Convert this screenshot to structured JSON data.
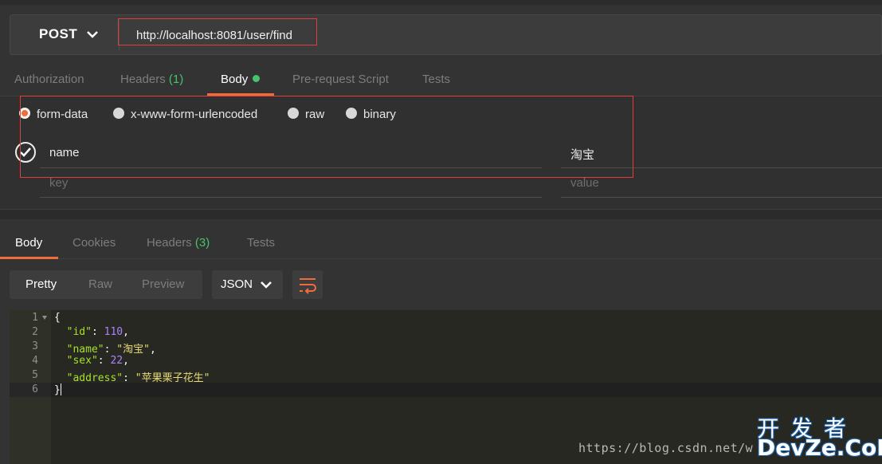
{
  "request": {
    "method": "POST",
    "url": "http://localhost:8081/user/find"
  },
  "request_tabs": [
    {
      "label": "Authorization",
      "count": ""
    },
    {
      "label": "Headers",
      "count": "(1)"
    },
    {
      "label": "Body",
      "count": ""
    },
    {
      "label": "Pre-request Script",
      "count": ""
    },
    {
      "label": "Tests",
      "count": ""
    }
  ],
  "body_modes": {
    "selected": "form-data",
    "options": [
      "form-data",
      "x-www-form-urlencoded",
      "raw",
      "binary"
    ]
  },
  "form": {
    "rows": [
      {
        "key": "name",
        "value": "淘宝",
        "checked": true
      }
    ],
    "key_placeholder": "key",
    "value_placeholder": "value"
  },
  "response_tabs": [
    {
      "label": "Body",
      "count": ""
    },
    {
      "label": "Cookies",
      "count": ""
    },
    {
      "label": "Headers",
      "count": "(3)"
    },
    {
      "label": "Tests",
      "count": ""
    }
  ],
  "response_view": {
    "options": [
      "Pretty",
      "Raw",
      "Preview"
    ],
    "selected": "Pretty",
    "format": "JSON"
  },
  "response_body": {
    "line_numbers": [
      "1",
      "2",
      "3",
      "4",
      "5",
      "6"
    ],
    "open_brace": "{",
    "close_brace": "}",
    "fields": [
      {
        "key": "\"id\"",
        "value": "110",
        "type": "number",
        "comma": ","
      },
      {
        "key": "\"name\"",
        "value": "\"淘宝\"",
        "type": "string",
        "comma": ","
      },
      {
        "key": "\"sex\"",
        "value": "22",
        "type": "number",
        "comma": ","
      },
      {
        "key": "\"address\"",
        "value": "\"苹果栗子花生\"",
        "type": "string",
        "comma": ""
      }
    ]
  },
  "watermark": {
    "url": "https://blog.csdn.net/w",
    "logo_cn": "开发者",
    "logo_en": "DevZe.CoM"
  },
  "colors": {
    "accent": "#f26b3a",
    "count_green": "#46c46a",
    "highlight_red": "#e23c3c"
  }
}
